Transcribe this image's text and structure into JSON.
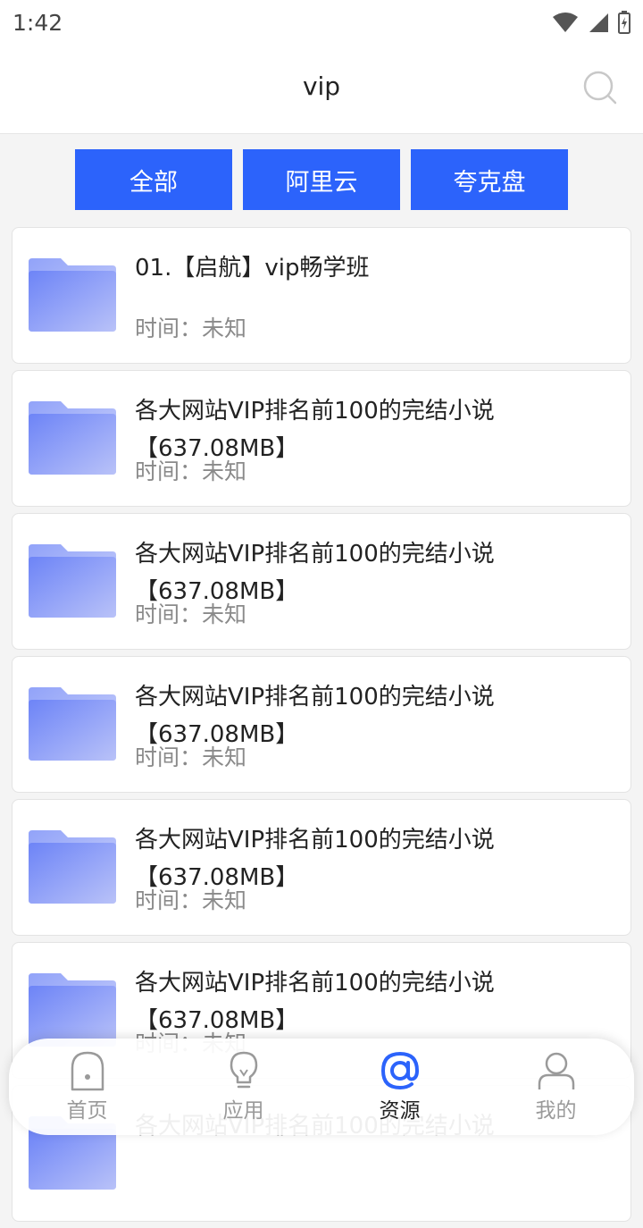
{
  "status_bar": {
    "time": "1:42"
  },
  "header": {
    "title": "vip"
  },
  "tabs": [
    {
      "label": "全部"
    },
    {
      "label": "阿里云"
    },
    {
      "label": "夸克盘"
    }
  ],
  "items": [
    {
      "name": "01.【启航】vip畅学班",
      "time_label": "时间：",
      "time_value": "未知"
    },
    {
      "name": "各大网站VIP排名前100的完结小说【637.08MB】",
      "time_label": "时间：",
      "time_value": "未知"
    },
    {
      "name": "各大网站VIP排名前100的完结小说【637.08MB】",
      "time_label": "时间：",
      "time_value": "未知"
    },
    {
      "name": "各大网站VIP排名前100的完结小说【637.08MB】",
      "time_label": "时间：",
      "time_value": "未知"
    },
    {
      "name": "各大网站VIP排名前100的完结小说【637.08MB】",
      "time_label": "时间：",
      "time_value": "未知"
    },
    {
      "name": "各大网站VIP排名前100的完结小说【637.08MB】",
      "time_label": "时间：",
      "time_value": "未知"
    },
    {
      "name": "各大网站VIP排名前100的完结小说",
      "time_label": "",
      "time_value": ""
    }
  ],
  "nav": [
    {
      "label": "首页",
      "icon": "home-icon",
      "active": false
    },
    {
      "label": "应用",
      "icon": "lightbulb-icon",
      "active": false
    },
    {
      "label": "资源",
      "icon": "at-icon",
      "active": true
    },
    {
      "label": "我的",
      "icon": "user-icon",
      "active": false
    }
  ],
  "colors": {
    "accent": "#2c63fb",
    "folder": "#7b8ef8"
  }
}
